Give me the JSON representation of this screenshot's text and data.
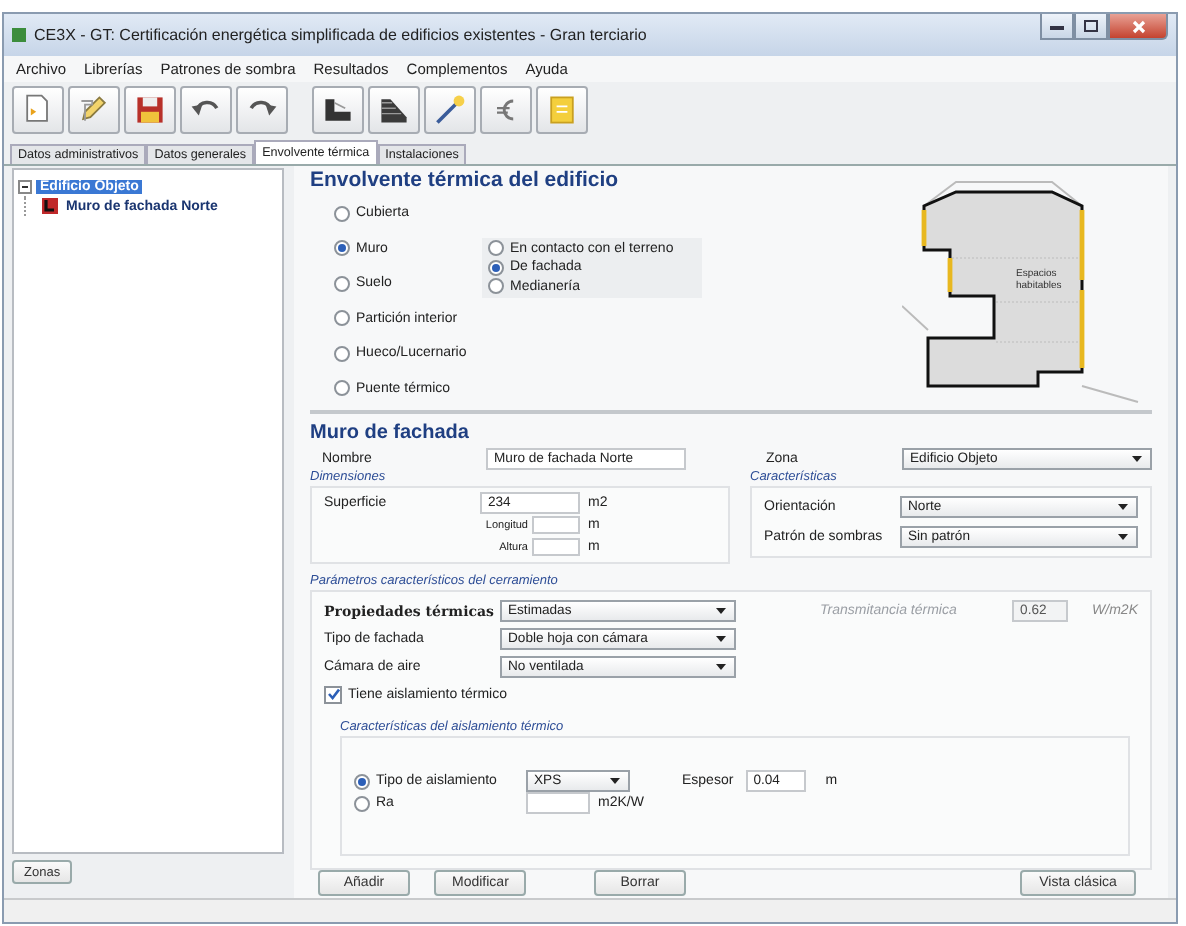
{
  "window": {
    "title": "CE3X - GT: Certificación energética simplificada de edificios existentes - Gran terciario"
  },
  "menu": [
    "Archivo",
    "Librerías",
    "Patrones de sombra",
    "Resultados",
    "Complementos",
    "Ayuda"
  ],
  "tabs": [
    {
      "label": "Datos administrativos",
      "selected": false
    },
    {
      "label": "Datos generales",
      "selected": false
    },
    {
      "label": "Envolvente térmica",
      "selected": true
    },
    {
      "label": "Instalaciones",
      "selected": false
    }
  ],
  "tree": [
    {
      "label": "Edificio Objeto",
      "selected": true,
      "expanded": true,
      "children": [
        {
          "label": "Muro de fachada Norte",
          "selected": false
        }
      ]
    }
  ],
  "zones_button": "Zonas",
  "envelope": {
    "title": "Envolvente térmica del edificio",
    "types": [
      {
        "label": "Cubierta",
        "selected": false
      },
      {
        "label": "Muro",
        "selected": true
      },
      {
        "label": "Suelo",
        "selected": false
      },
      {
        "label": "Partición interior",
        "selected": false
      },
      {
        "label": "Hueco/Lucernario",
        "selected": false
      },
      {
        "label": "Puente térmico",
        "selected": false
      }
    ],
    "subtypes": [
      {
        "label": "En contacto con el terreno",
        "selected": false
      },
      {
        "label": "De fachada",
        "selected": true
      },
      {
        "label": "Medianería",
        "selected": false
      }
    ],
    "diagram_label": [
      "Espacios",
      "habitables"
    ]
  },
  "element": {
    "title": "Muro de fachada",
    "name": {
      "label": "Nombre",
      "value": "Muro de fachada Norte"
    },
    "zone": {
      "label": "Zona",
      "value": "Edificio Objeto"
    },
    "dimensions": {
      "title": "Dimensiones",
      "area": {
        "label": "Superficie",
        "value": "234",
        "unit": "m2"
      },
      "sizes": [
        {
          "label": "Longitud",
          "unit": "m"
        },
        {
          "label": "Altura",
          "unit": "m"
        }
      ]
    },
    "characteristics": {
      "title": "Características",
      "fields": [
        {
          "label": "Orientación",
          "value": "Norte"
        },
        {
          "label": "Patrón de sombras",
          "value": "Sin patrón"
        }
      ]
    },
    "parameters": {
      "title": "Parámetros característicos del cerramiento",
      "fields": [
        {
          "label": "Propiedades térmicas",
          "value": "Estimadas"
        },
        {
          "label": "Tipo de fachada",
          "value": "Doble hoja con cámara"
        },
        {
          "label": "Cámara de aire",
          "value": "No ventilada"
        }
      ],
      "transmittance": {
        "label": "Transmitancia térmica",
        "value": "0.62",
        "unit": "W/m2K",
        "disabled": true
      },
      "insulated": {
        "label": "Tiene aislamiento térmico",
        "checked": true
      },
      "insulation": {
        "title": "Características del aislamiento térmico",
        "options": [
          {
            "kind": "select",
            "label": "Tipo de aislamiento",
            "value": "XPS",
            "selected": true
          },
          {
            "kind": "input",
            "label": "Ra",
            "unit": "m2K/W",
            "selected": false
          }
        ],
        "thickness": {
          "label": "Espesor",
          "value": "0.04",
          "unit": "m"
        }
      }
    }
  },
  "buttons": [
    "Añadir",
    "Modificar",
    "Borrar"
  ],
  "classic_button": "Vista clásica"
}
